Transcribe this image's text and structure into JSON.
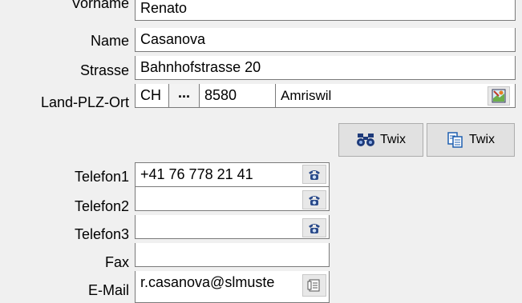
{
  "labels": {
    "vorname": "Vorname",
    "name": "Name",
    "strasse": "Strasse",
    "land_plz_ort": "Land-PLZ-Ort",
    "telefon1": "Telefon1",
    "telefon2": "Telefon2",
    "telefon3": "Telefon3",
    "fax": "Fax",
    "email": "E-Mail"
  },
  "values": {
    "vorname": "Renato",
    "name": "Casanova",
    "strasse": "Bahnhofstrasse 20",
    "land": "CH",
    "land_picker": "...",
    "plz": "8580",
    "ort": "Amriswil",
    "telefon1": "+41 76 778 21 41",
    "telefon2": "",
    "telefon3": "",
    "fax": "",
    "email": "r.casanova@slmuste"
  },
  "buttons": {
    "twix_search": "Twix",
    "twix_copy": "Twix"
  },
  "icons": {
    "map": "map-icon",
    "binoculars": "binoculars-icon",
    "copy": "copy-icon",
    "phone": "phone-icon",
    "email": "email-icon"
  },
  "colors": {
    "background": "#f0f0f0",
    "field": "#ffffff",
    "phone_icon": "#2a4a8a"
  }
}
